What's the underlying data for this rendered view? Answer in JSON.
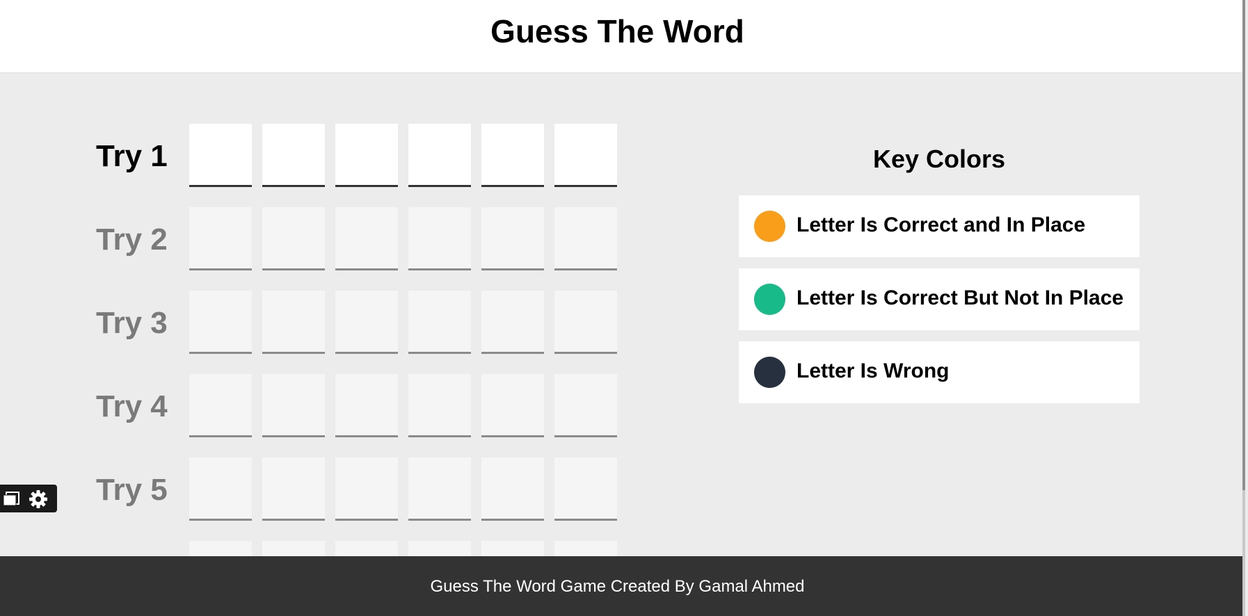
{
  "header": {
    "title": "Guess The Word"
  },
  "game": {
    "tries": [
      {
        "label": "Try 1",
        "active": true
      },
      {
        "label": "Try 2",
        "active": false
      },
      {
        "label": "Try 3",
        "active": false
      },
      {
        "label": "Try 4",
        "active": false
      },
      {
        "label": "Try 5",
        "active": false
      },
      {
        "label": "",
        "active": false
      }
    ],
    "letters_per_try": 6
  },
  "key_colors": {
    "title": "Key Colors",
    "items": [
      {
        "label": "Letter Is Correct and In Place",
        "color": "#f89e1b"
      },
      {
        "label": "Letter Is Correct But Not In Place",
        "color": "#18ba89"
      },
      {
        "label": "Letter Is Wrong",
        "color": "#27303f"
      }
    ]
  },
  "toolbar": {
    "icons": [
      "window-icon",
      "gear-icon"
    ]
  },
  "footer": {
    "text": "Guess The Word Game Created By Gamal Ahmed"
  }
}
